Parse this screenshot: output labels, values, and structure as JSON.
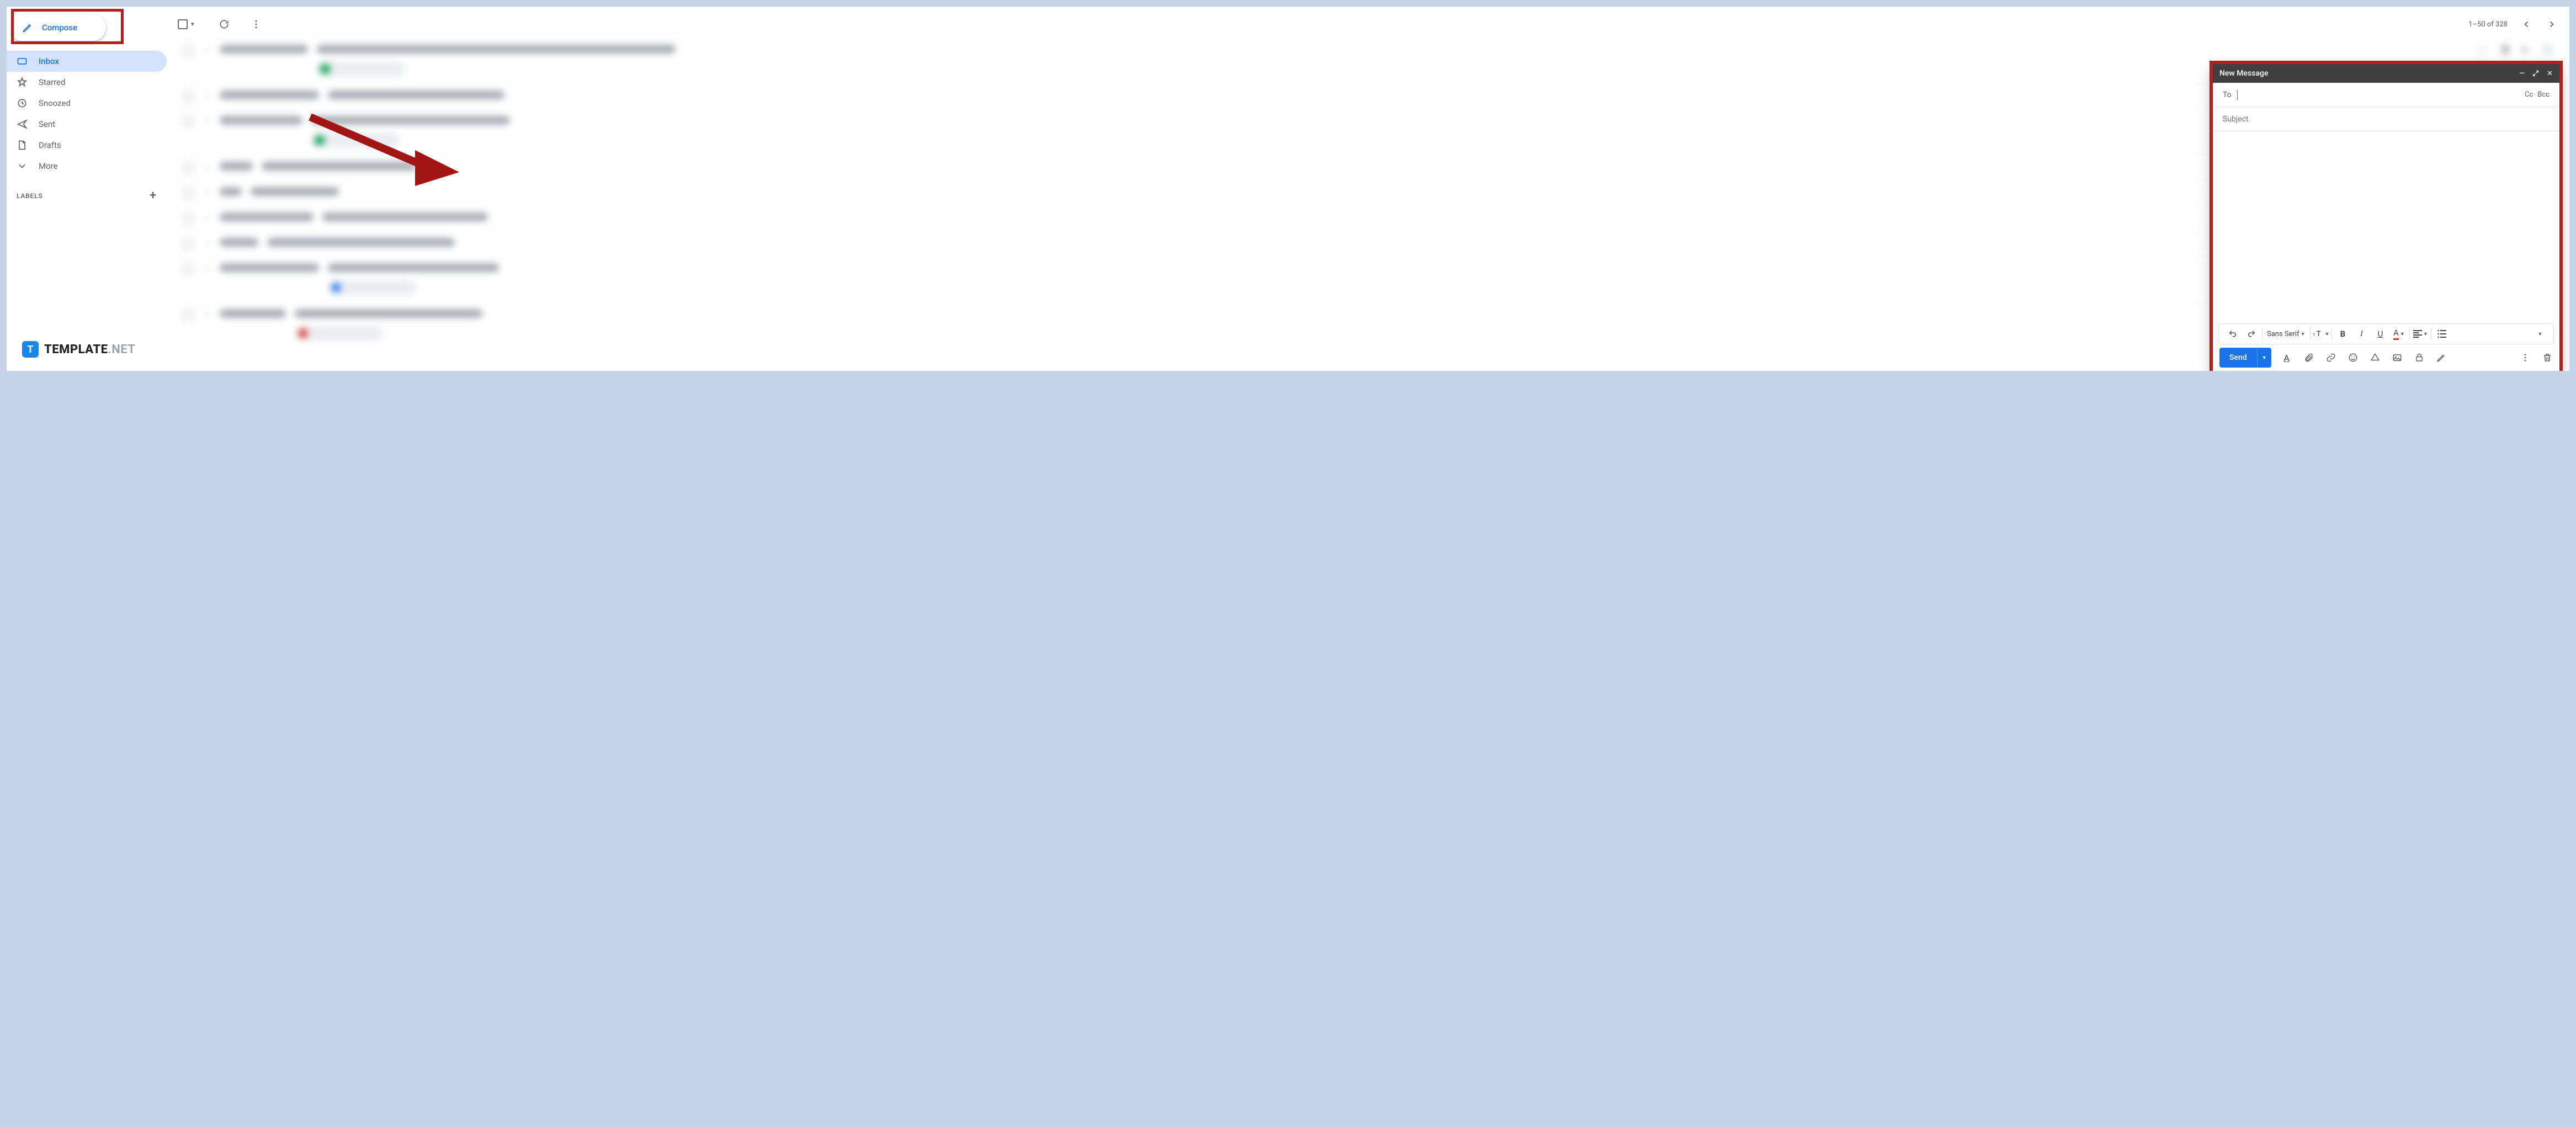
{
  "sidebar": {
    "compose_label": "Compose",
    "items": [
      {
        "label": "Inbox",
        "icon": "inbox-icon",
        "active": true
      },
      {
        "label": "Starred",
        "icon": "star-icon",
        "active": false
      },
      {
        "label": "Snoozed",
        "icon": "clock-icon",
        "active": false
      },
      {
        "label": "Sent",
        "icon": "send-icon",
        "active": false
      },
      {
        "label": "Drafts",
        "icon": "draft-icon",
        "active": false
      },
      {
        "label": "More",
        "icon": "chevron-down-icon",
        "active": false
      }
    ],
    "labels_header": "LABELS"
  },
  "toolbar": {
    "page_counter": "1–50 of 328"
  },
  "compose": {
    "title": "New Message",
    "to_label": "To",
    "cc_label": "Cc",
    "bcc_label": "Bcc",
    "subject_placeholder": "Subject",
    "font_name": "Sans Serif",
    "send_label": "Send"
  },
  "watermark": {
    "brand": "TEMPLATE",
    "ext": ".NET"
  }
}
